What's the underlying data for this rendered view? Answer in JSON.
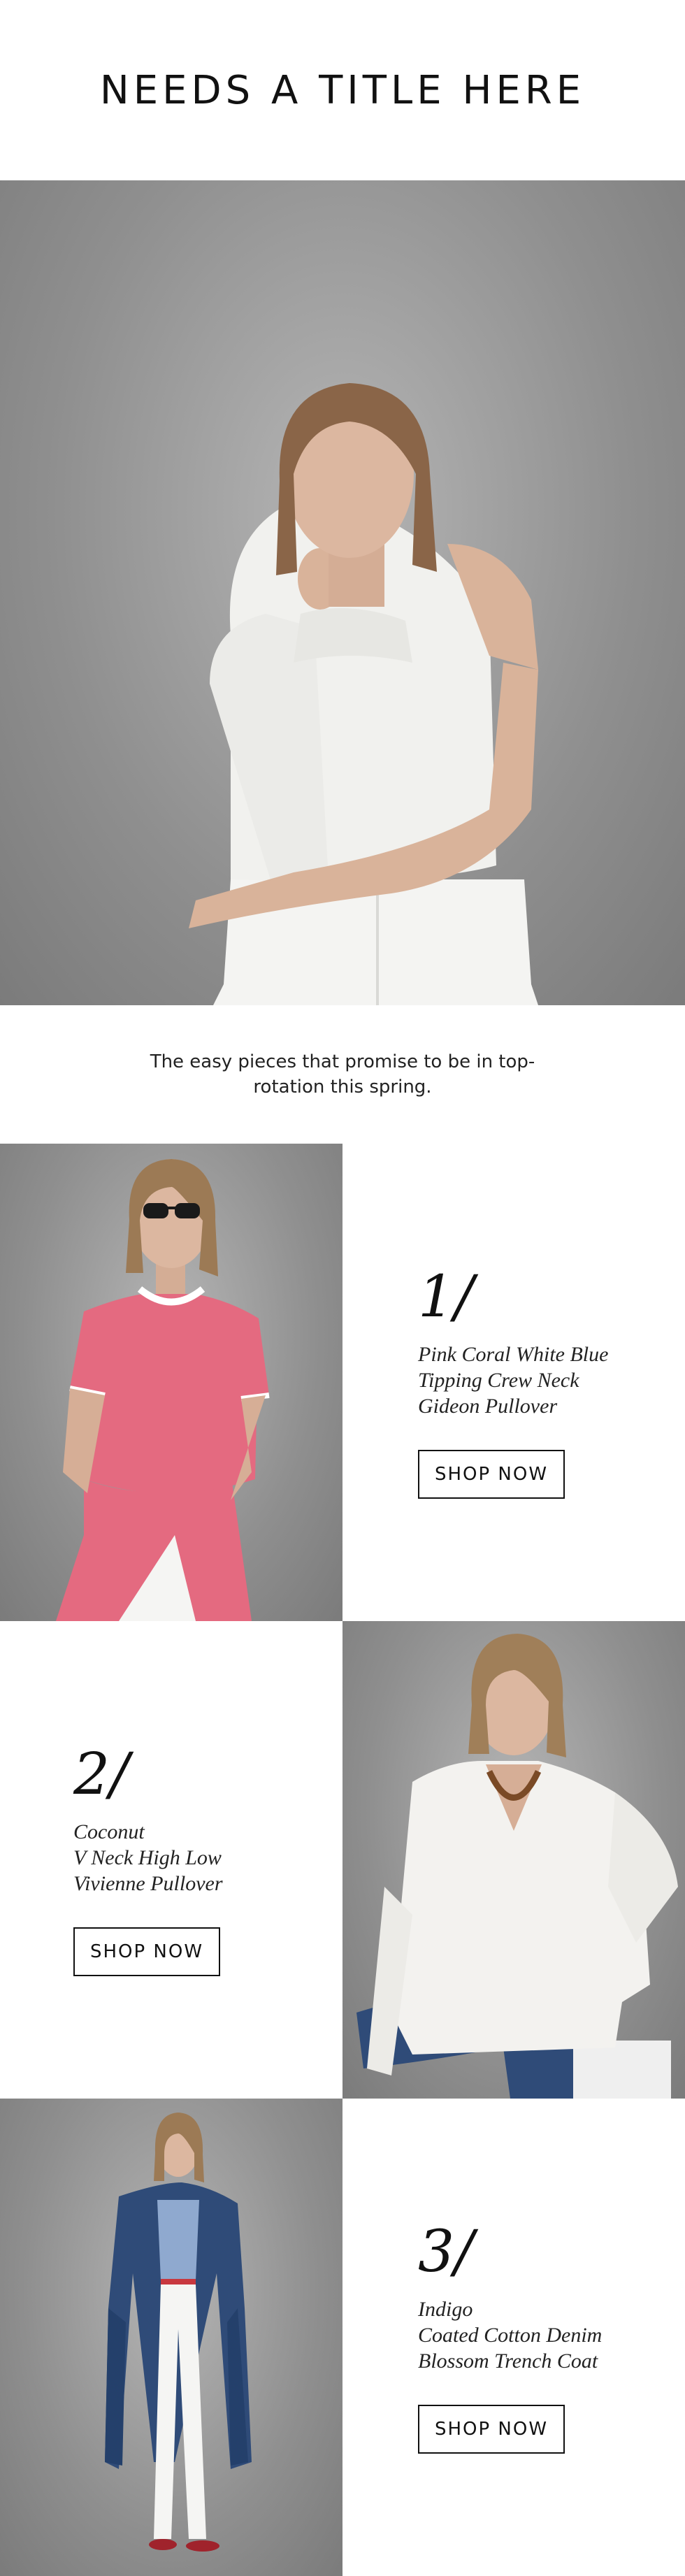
{
  "header": {
    "title": "NEEDS A TITLE HERE"
  },
  "intro": {
    "text": "The easy pieces that promise to be in top-rotation this spring."
  },
  "products": [
    {
      "number": "1/",
      "name_lines": [
        "Pink Coral White Blue",
        "Tipping Crew Neck",
        "Gideon Pullover"
      ],
      "cta": "SHOP NOW"
    },
    {
      "number": "2/",
      "name_lines": [
        "Coconut",
        "V Neck High Low",
        "Vivienne Pullover"
      ],
      "cta": "SHOP NOW"
    },
    {
      "number": "3/",
      "name_lines": [
        "Indigo",
        "Coated Cotton Denim",
        "Blossom Trench Coat"
      ],
      "cta": "SHOP NOW"
    }
  ],
  "colors": {
    "background": "#ffffff",
    "photo_backdrop": "#8f8f8f",
    "text": "#111111",
    "pink_coral": "#e46a80",
    "indigo": "#2f4b78"
  }
}
